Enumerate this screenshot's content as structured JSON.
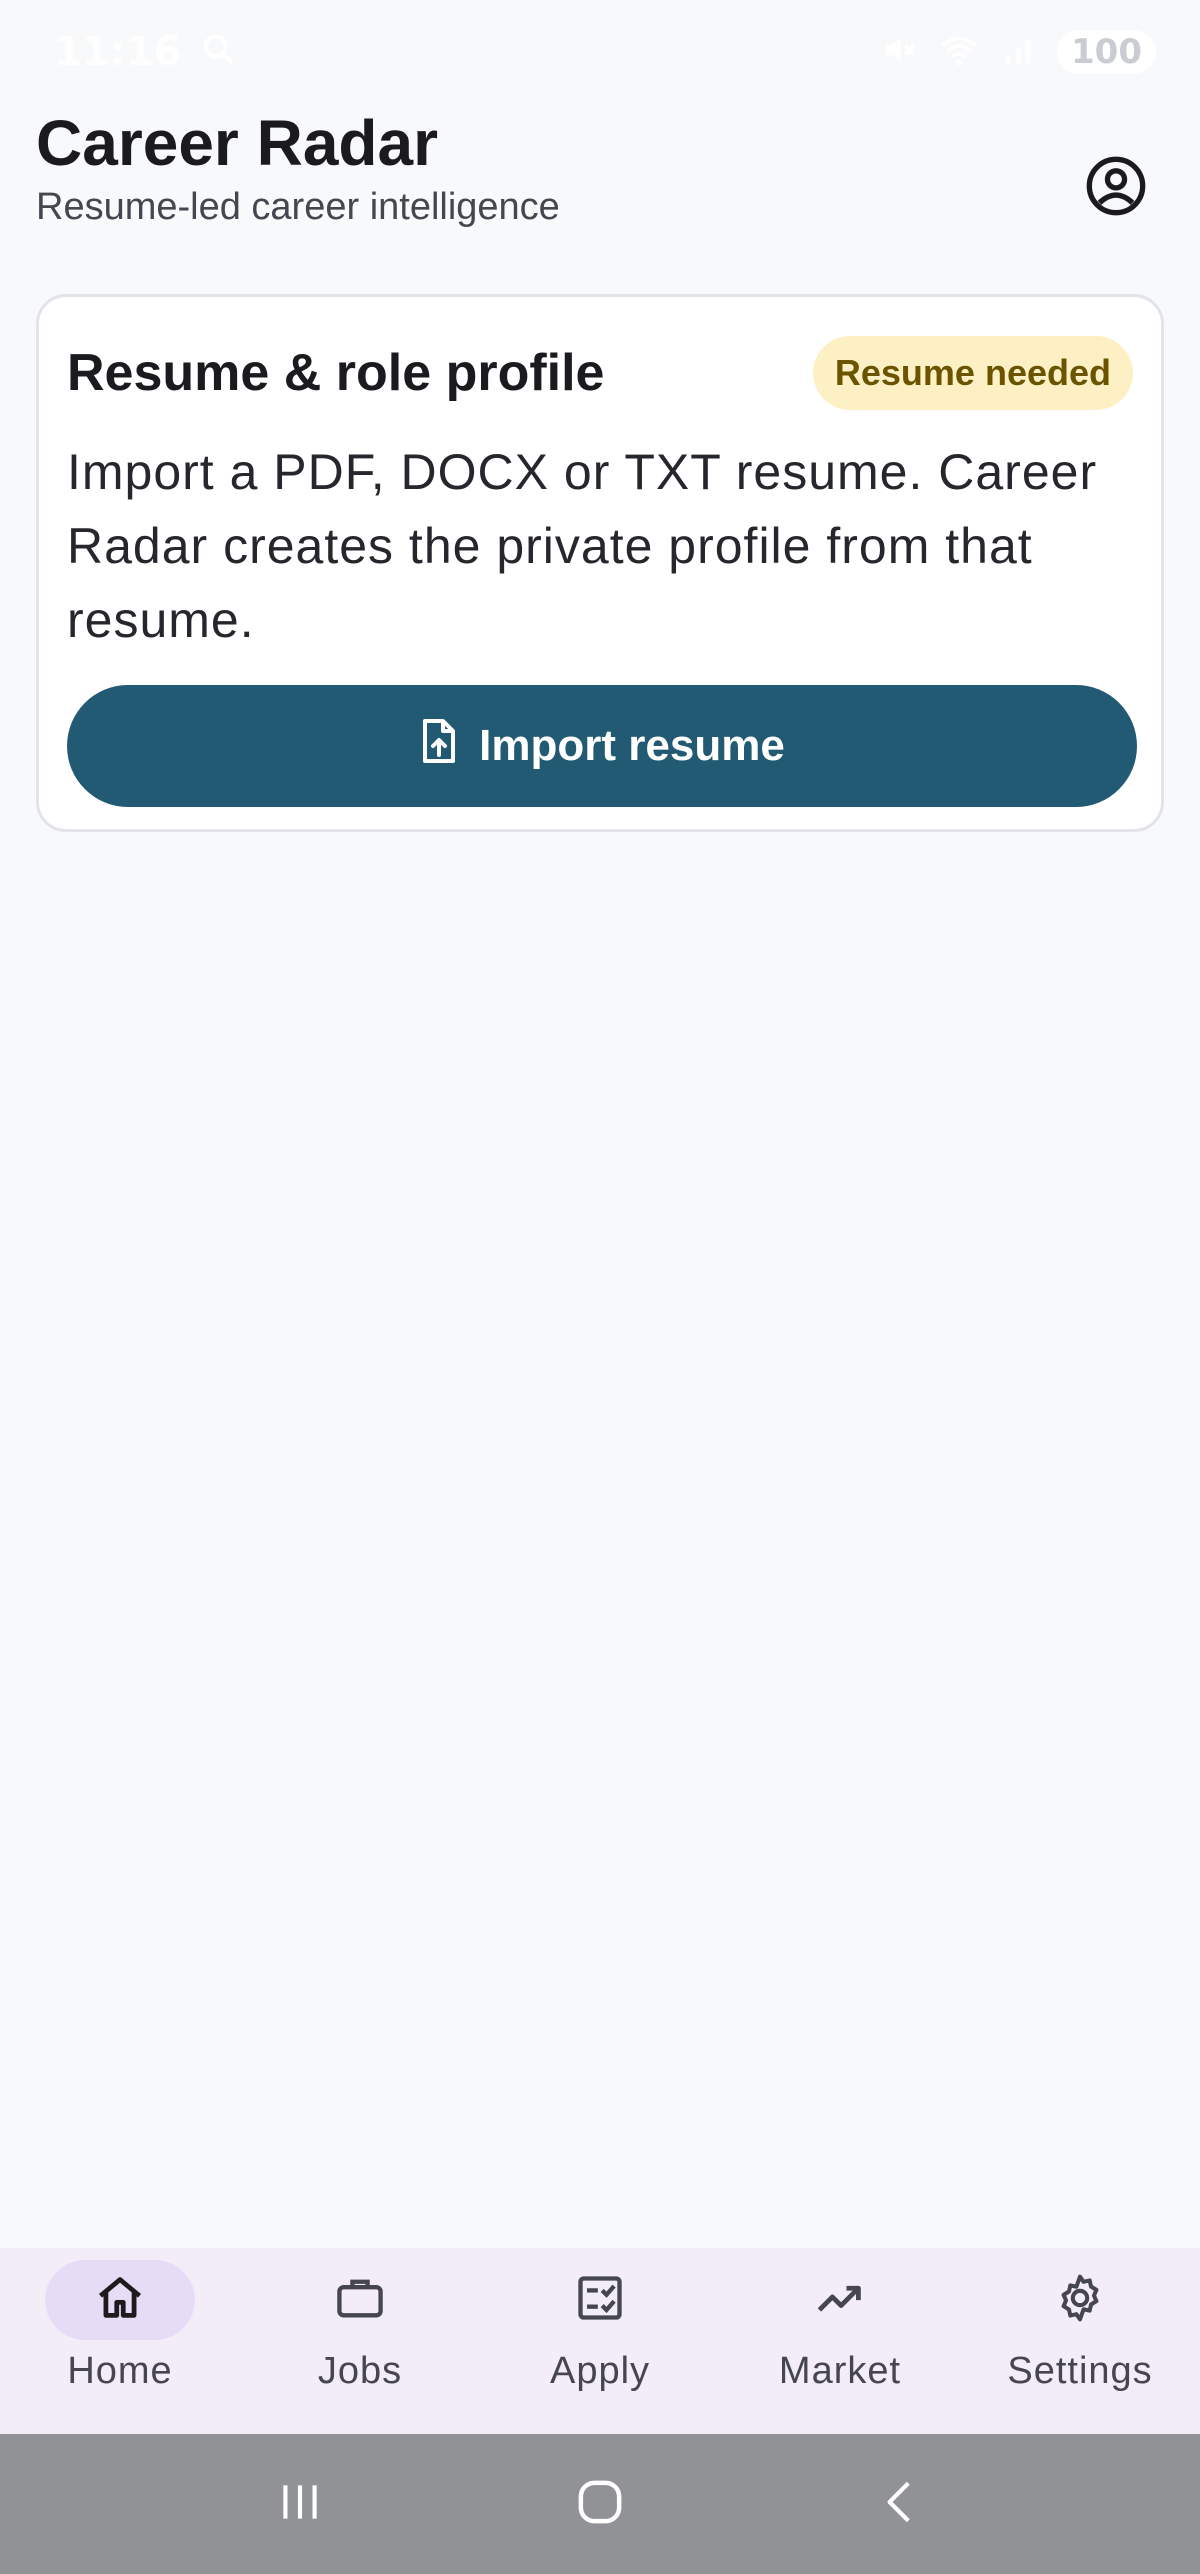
{
  "status_bar": {
    "time": "11:16",
    "battery": "100"
  },
  "header": {
    "title": "Career Radar",
    "subtitle": "Resume-led career intelligence",
    "account_icon": "account-circle-icon"
  },
  "profile_card": {
    "title": "Resume & role profile",
    "badge": "Resume needed",
    "body": "Import a PDF, DOCX or TXT resume. Career Radar creates the private profile from that resume.",
    "button_label": "Import resume",
    "button_icon": "file-upload-icon"
  },
  "bottom_nav": {
    "items": [
      {
        "label": "Home",
        "icon": "home-icon",
        "active": true
      },
      {
        "label": "Jobs",
        "icon": "briefcase-icon",
        "active": false
      },
      {
        "label": "Apply",
        "icon": "checklist-icon",
        "active": false
      },
      {
        "label": "Market",
        "icon": "trending-up-icon",
        "active": false
      },
      {
        "label": "Settings",
        "icon": "gear-icon",
        "active": false
      }
    ]
  },
  "colors": {
    "primary": "#225a73",
    "badge_bg": "#fdf0c4",
    "badge_text": "#6a5400",
    "nav_bg": "#f3edf7",
    "nav_active": "#e7dcf5",
    "background": "#f8f9fb"
  }
}
